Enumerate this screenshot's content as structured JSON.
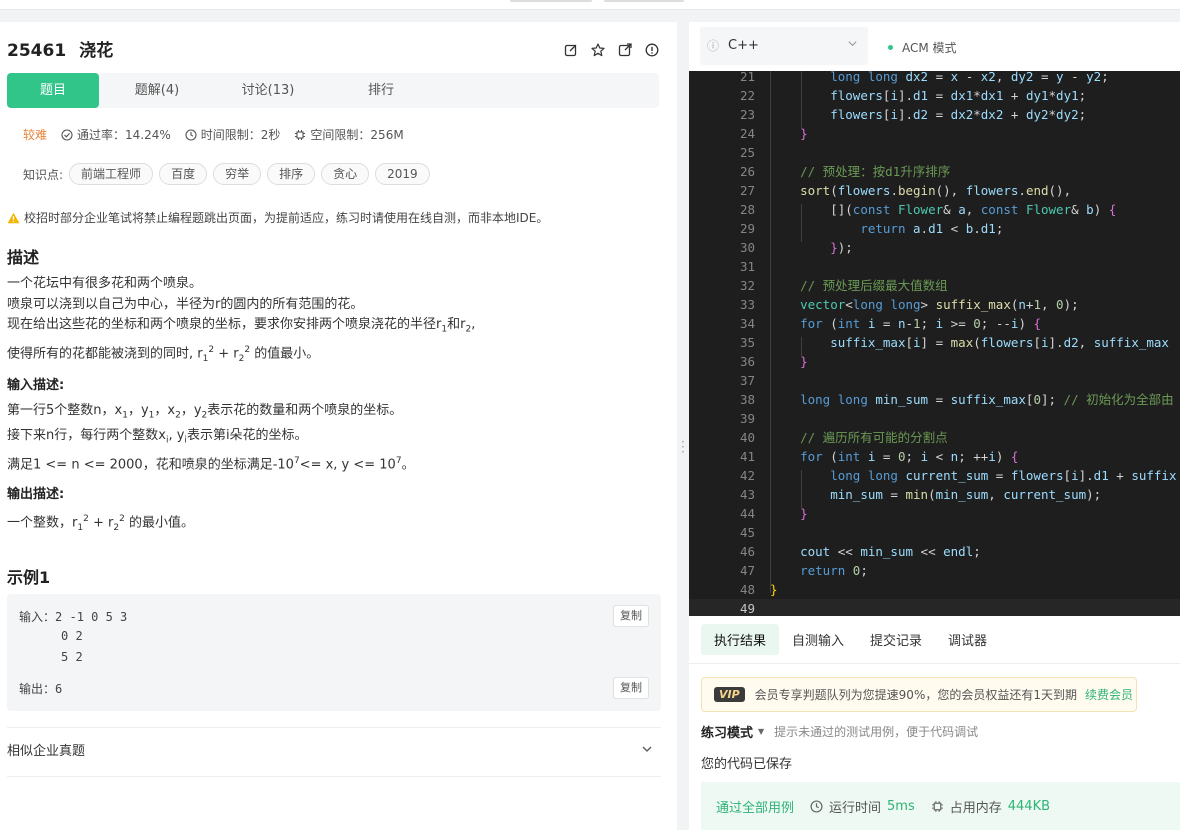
{
  "problem": {
    "id": "25461",
    "title": "浇花",
    "tabs": [
      "题目",
      "题解(4)",
      "讨论(13)",
      "排行"
    ],
    "difficulty": "较难",
    "pass_rate": "通过率：14.24%",
    "time_limit": "时间限制：2秒",
    "space_limit": "空间限制：256M",
    "knowledge_label": "知识点:",
    "tags": [
      "前端工程师",
      "百度",
      "穷举",
      "排序",
      "贪心",
      "2019"
    ],
    "warning": "校招时部分企业笔试将禁止编程题跳出页面，为提前适应，练习时请使用在线自测，而非本地IDE。",
    "desc_title": "描述",
    "desc_lines": [
      "一个花坛中有很多花和两个喷泉。",
      "喷泉可以浇到以自己为中心，半径为r的圆内的所有范围的花。"
    ],
    "desc_line3_a": "现在给出这些花的坐标和两个喷泉的坐标，要求你安排两个喷泉浇花的半径r",
    "desc_line3_b": "和r",
    "desc_line3_c": ",",
    "desc_line4_a": "使得所有的花都能被浇到的同时, r",
    "desc_line4_b": " + r",
    "desc_line4_c": " 的值最小。",
    "input_title": "输入描述:",
    "input_line1_a": "第一行5个整数n，x",
    "input_line1_b": "，y",
    "input_line1_c": "，x",
    "input_line1_d": "，y",
    "input_line1_e": "表示花的数量和两个喷泉的坐标。",
    "input_line2_a": "接下来n行，每行两个整数x",
    "input_line2_b": ", y",
    "input_line2_c": "表示第i朵花的坐标。",
    "input_line3_a": "满足1 <= n <= 2000，花和喷泉的坐标满足-10",
    "input_line3_b": "<= x, y <= 10",
    "input_line3_c": "。",
    "output_title": "输出描述:",
    "output_line_a": "一个整数，r",
    "output_line_b": " + r",
    "output_line_c": " 的最小值。",
    "example_title": "示例1",
    "example_input_label": "输入：",
    "example_input_lines": [
      "2 -1 0 5 3",
      "0 2",
      "5 2"
    ],
    "example_output_label": "输出：",
    "example_output": "6",
    "copy_label": "复制",
    "similar": "相似企业真题"
  },
  "editor": {
    "language": "C++",
    "mode": "ACM 模式",
    "line_numbers": [
      "21",
      "22",
      "23",
      "24",
      "25",
      "26",
      "27",
      "28",
      "29",
      "30",
      "31",
      "32",
      "33",
      "34",
      "35",
      "36",
      "37",
      "38",
      "39",
      "40",
      "41",
      "42",
      "43",
      "44",
      "45",
      "46",
      "47",
      "48",
      "49"
    ]
  },
  "bottom": {
    "tabs": [
      "执行结果",
      "自测输入",
      "提交记录",
      "调试器"
    ],
    "vip_badge": "VIP",
    "vip_text": "会员专享判题队列为您提速90%，您的会员权益还有1天到期",
    "vip_renew": "续费会员",
    "practice_label": "练习模式",
    "practice_hint": "提示未通过的测试用例，便于代码调试",
    "saved": "您的代码已保存",
    "pass_all": "通过全部用例",
    "runtime_label": "运行时间",
    "runtime_value": "5ms",
    "memory_label": "占用内存",
    "memory_value": "444KB"
  },
  "colors": {
    "accent": "#32c589",
    "difficulty": "#e8833a",
    "editor_bg": "#1e1e1e"
  }
}
